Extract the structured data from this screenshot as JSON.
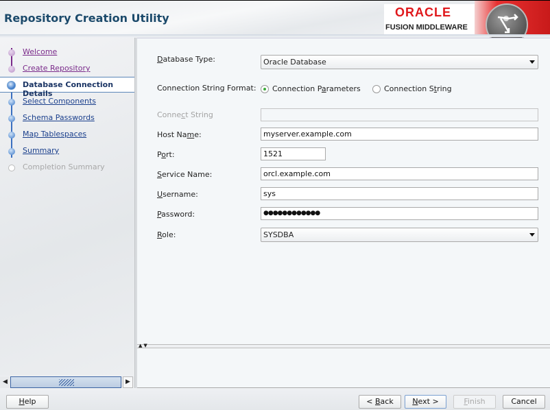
{
  "window": {
    "title": "Repository Creation Utility",
    "brand": {
      "oracle": "ORACLE",
      "product": "FUSION MIDDLEWARE",
      "accent": "#e0171b"
    }
  },
  "sidebar": {
    "steps": [
      {
        "label": "Welcome",
        "state": "done"
      },
      {
        "label": "Create Repository",
        "state": "done"
      },
      {
        "label": "Database Connection Details",
        "state": "current"
      },
      {
        "label": "Select Components",
        "state": "todo"
      },
      {
        "label": "Schema Passwords",
        "state": "todo"
      },
      {
        "label": "Map Tablespaces",
        "state": "todo"
      },
      {
        "label": "Summary",
        "state": "todo"
      },
      {
        "label": "Completion Summary",
        "state": "disabled"
      }
    ]
  },
  "form": {
    "database_type": {
      "label_mn": "D",
      "label_rest": "atabase Type:",
      "value": "Oracle Database"
    },
    "conn_format": {
      "label": "Connection String Format:",
      "options": [
        {
          "pre": "Connection P",
          "mn": "a",
          "post": "rameters",
          "selected": true
        },
        {
          "pre": "Connection S",
          "mn": "t",
          "post": "ring",
          "selected": false
        }
      ]
    },
    "connect_string": {
      "pre": "Conne",
      "mn": "c",
      "post": "t String",
      "value": ""
    },
    "host_name": {
      "pre": "Host Na",
      "mn": "m",
      "post": "e:",
      "value": "myserver.example.com"
    },
    "port": {
      "pre": "P",
      "mn": "o",
      "post": "rt:",
      "value": "1521"
    },
    "service_name": {
      "pre": "",
      "mn": "S",
      "post": "ervice Name:",
      "value": "orcl.example.com"
    },
    "username": {
      "pre": "",
      "mn": "U",
      "post": "sername:",
      "value": "sys"
    },
    "password": {
      "pre": "",
      "mn": "P",
      "post": "assword:",
      "value": "●●●●●●●●●●●●"
    },
    "role": {
      "pre": "",
      "mn": "R",
      "post": "ole:",
      "value": "SYSDBA"
    }
  },
  "buttons": {
    "help": {
      "mn": "H",
      "post": "elp"
    },
    "back": {
      "pre": "< ",
      "mn": "B",
      "post": "ack"
    },
    "next": {
      "mn": "N",
      "post": "ext >"
    },
    "finish": {
      "mn": "F",
      "post": "inish"
    },
    "cancel": "Cancel"
  }
}
